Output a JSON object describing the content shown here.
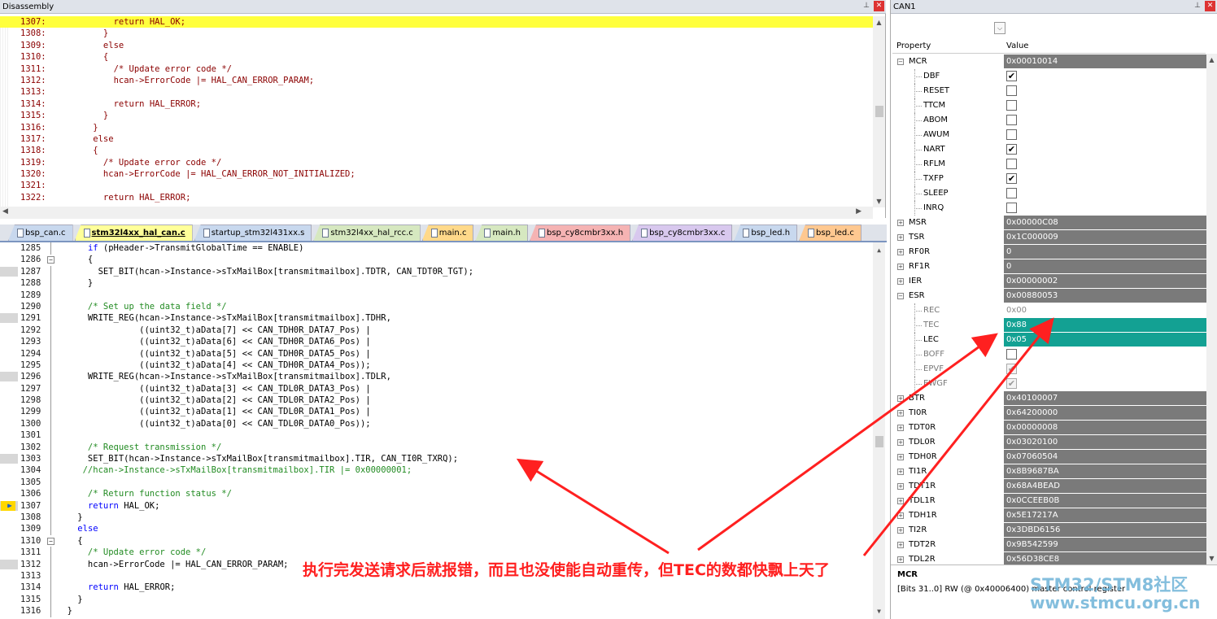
{
  "disassembly": {
    "title": "Disassembly",
    "lines": [
      {
        "num": "1307:",
        "text": "        return HAL_OK;",
        "highlight": true
      },
      {
        "num": "1308:",
        "text": "      }"
      },
      {
        "num": "1309:",
        "text": "      else"
      },
      {
        "num": "1310:",
        "text": "      {"
      },
      {
        "num": "1311:",
        "text": "        /* Update error code */"
      },
      {
        "num": "1312:",
        "text": "        hcan->ErrorCode |= HAL_CAN_ERROR_PARAM;"
      },
      {
        "num": "1313:",
        "text": ""
      },
      {
        "num": "1314:",
        "text": "        return HAL_ERROR;"
      },
      {
        "num": "1315:",
        "text": "      }"
      },
      {
        "num": "1316:",
        "text": "    }"
      },
      {
        "num": "1317:",
        "text": "    else"
      },
      {
        "num": "1318:",
        "text": "    {"
      },
      {
        "num": "1319:",
        "text": "      /* Update error code */"
      },
      {
        "num": "1320:",
        "text": "      hcan->ErrorCode |= HAL_CAN_ERROR_NOT_INITIALIZED;"
      },
      {
        "num": "1321:",
        "text": ""
      },
      {
        "num": "1322:",
        "text": "      return HAL_ERROR;"
      }
    ]
  },
  "tabs": [
    {
      "label": "bsp_can.c",
      "color": "#c8d8ee"
    },
    {
      "label": "stm32l4xx_hal_can.c",
      "color": "#ffff99",
      "active": true
    },
    {
      "label": "startup_stm32l431xx.s",
      "color": "#c8d8ee"
    },
    {
      "label": "stm32l4xx_hal_rcc.c",
      "color": "#d6e8c0"
    },
    {
      "label": "main.c",
      "color": "#ffd98a"
    },
    {
      "label": "main.h",
      "color": "#d6e8c0"
    },
    {
      "label": "bsp_cy8cmbr3xx.h",
      "color": "#f5b3b3"
    },
    {
      "label": "bsp_cy8cmbr3xx.c",
      "color": "#d8c8ee"
    },
    {
      "label": "bsp_led.h",
      "color": "#c8d8ee"
    },
    {
      "label": "bsp_led.c",
      "color": "#ffc890"
    }
  ],
  "tab_controls": {
    "menu": "▼",
    "close": "✕"
  },
  "editor": {
    "lines": [
      {
        "num": "1285",
        "code": [
          [
            "      ",
            ""
          ],
          [
            "if",
            "k"
          ],
          [
            " (pHeader->TransmitGlobalTime == ENABLE)",
            ""
          ]
        ]
      },
      {
        "num": "1286",
        "fold": "−",
        "code": [
          [
            "      {",
            ""
          ]
        ]
      },
      {
        "num": "1287",
        "mark": true,
        "code": [
          [
            "        SET_BIT(hcan->Instance->sTxMailBox[transmitmailbox].TDTR, CAN_TDT0R_TGT);",
            ""
          ]
        ]
      },
      {
        "num": "1288",
        "code": [
          [
            "      }",
            ""
          ]
        ]
      },
      {
        "num": "1289",
        "code": [
          [
            "",
            ""
          ]
        ]
      },
      {
        "num": "1290",
        "code": [
          [
            "      /* Set up the data field */",
            "g"
          ]
        ]
      },
      {
        "num": "1291",
        "mark": true,
        "code": [
          [
            "      WRITE_REG(hcan->Instance->sTxMailBox[transmitmailbox].TDHR,",
            ""
          ]
        ]
      },
      {
        "num": "1292",
        "code": [
          [
            "                ((uint32_t)aData[7] << CAN_TDH0R_DATA7_Pos) |",
            ""
          ]
        ]
      },
      {
        "num": "1293",
        "code": [
          [
            "                ((uint32_t)aData[6] << CAN_TDH0R_DATA6_Pos) |",
            ""
          ]
        ]
      },
      {
        "num": "1294",
        "code": [
          [
            "                ((uint32_t)aData[5] << CAN_TDH0R_DATA5_Pos) |",
            ""
          ]
        ]
      },
      {
        "num": "1295",
        "code": [
          [
            "                ((uint32_t)aData[4] << CAN_TDH0R_DATA4_Pos));",
            ""
          ]
        ]
      },
      {
        "num": "1296",
        "mark": true,
        "code": [
          [
            "      WRITE_REG(hcan->Instance->sTxMailBox[transmitmailbox].TDLR,",
            ""
          ]
        ]
      },
      {
        "num": "1297",
        "code": [
          [
            "                ((uint32_t)aData[3] << CAN_TDL0R_DATA3_Pos) |",
            ""
          ]
        ]
      },
      {
        "num": "1298",
        "code": [
          [
            "                ((uint32_t)aData[2] << CAN_TDL0R_DATA2_Pos) |",
            ""
          ]
        ]
      },
      {
        "num": "1299",
        "code": [
          [
            "                ((uint32_t)aData[1] << CAN_TDL0R_DATA1_Pos) |",
            ""
          ]
        ]
      },
      {
        "num": "1300",
        "code": [
          [
            "                ((uint32_t)aData[0] << CAN_TDL0R_DATA0_Pos));",
            ""
          ]
        ]
      },
      {
        "num": "1301",
        "code": [
          [
            "",
            ""
          ]
        ]
      },
      {
        "num": "1302",
        "code": [
          [
            "      /* Request transmission */",
            "g"
          ]
        ]
      },
      {
        "num": "1303",
        "mark": true,
        "code": [
          [
            "      SET_BIT(hcan->Instance->sTxMailBox[transmitmailbox].TIR, CAN_TI0R_TXRQ);",
            ""
          ]
        ]
      },
      {
        "num": "1304",
        "code": [
          [
            "     //hcan->Instance->sTxMailBox[transmitmailbox].TIR |= 0x00000001;",
            "g"
          ]
        ]
      },
      {
        "num": "1305",
        "code": [
          [
            "",
            ""
          ]
        ]
      },
      {
        "num": "1306",
        "code": [
          [
            "      /* Return function status */",
            "g"
          ]
        ]
      },
      {
        "num": "1307",
        "mark": true,
        "current": true,
        "code": [
          [
            "      ",
            ""
          ],
          [
            "return",
            "k"
          ],
          [
            " HAL_OK;",
            ""
          ]
        ]
      },
      {
        "num": "1308",
        "code": [
          [
            "    }",
            ""
          ]
        ]
      },
      {
        "num": "1309",
        "code": [
          [
            "    ",
            ""
          ],
          [
            "else",
            "k"
          ]
        ]
      },
      {
        "num": "1310",
        "fold": "−",
        "code": [
          [
            "    {",
            ""
          ]
        ]
      },
      {
        "num": "1311",
        "code": [
          [
            "      /* Update error code */",
            "g"
          ]
        ]
      },
      {
        "num": "1312",
        "mark": true,
        "code": [
          [
            "      hcan->ErrorCode |= HAL_CAN_ERROR_PARAM;",
            ""
          ]
        ]
      },
      {
        "num": "1313",
        "code": [
          [
            "",
            ""
          ]
        ]
      },
      {
        "num": "1314",
        "code": [
          [
            "      ",
            ""
          ],
          [
            "return",
            "k"
          ],
          [
            " HAL_ERROR;",
            ""
          ]
        ]
      },
      {
        "num": "1315",
        "code": [
          [
            "    }",
            ""
          ]
        ]
      },
      {
        "num": "1316",
        "code": [
          [
            "  }",
            ""
          ]
        ]
      }
    ]
  },
  "can_panel": {
    "title": "CAN1",
    "header": {
      "property": "Property",
      "value": "Value"
    },
    "rows": [
      {
        "name": "MCR",
        "value": "0x00010014",
        "kind": "expanded",
        "style": "dark"
      },
      {
        "name": "DBF",
        "check": true,
        "kind": "child"
      },
      {
        "name": "RESET",
        "check": false,
        "kind": "child"
      },
      {
        "name": "TTCM",
        "check": false,
        "kind": "child"
      },
      {
        "name": "ABOM",
        "check": false,
        "kind": "child"
      },
      {
        "name": "AWUM",
        "check": false,
        "kind": "child"
      },
      {
        "name": "NART",
        "check": true,
        "kind": "child"
      },
      {
        "name": "RFLM",
        "check": false,
        "kind": "child"
      },
      {
        "name": "TXFP",
        "check": true,
        "kind": "child"
      },
      {
        "name": "SLEEP",
        "check": false,
        "kind": "child"
      },
      {
        "name": "INRQ",
        "check": false,
        "kind": "child"
      },
      {
        "name": "MSR",
        "value": "0x00000C08",
        "kind": "collapsed",
        "style": "dark"
      },
      {
        "name": "TSR",
        "value": "0x1C000009",
        "kind": "collapsed",
        "style": "dark"
      },
      {
        "name": "RF0R",
        "value": "0",
        "kind": "collapsed",
        "style": "dark"
      },
      {
        "name": "RF1R",
        "value": "0",
        "kind": "collapsed",
        "style": "dark"
      },
      {
        "name": "IER",
        "value": "0x00000002",
        "kind": "collapsed",
        "style": "dark"
      },
      {
        "name": "ESR",
        "value": "0x00880053",
        "kind": "expanded",
        "style": "dark"
      },
      {
        "name": "REC",
        "value": "0x00",
        "kind": "child",
        "style": "plain",
        "dim": true
      },
      {
        "name": "TEC",
        "value": "0x88",
        "kind": "child",
        "style": "teal",
        "dim": true
      },
      {
        "name": "LEC",
        "value": "0x05",
        "kind": "child",
        "style": "teal"
      },
      {
        "name": "BOFF",
        "check": false,
        "kind": "child",
        "dim": true
      },
      {
        "name": "EPVF",
        "check": true,
        "kind": "child",
        "dim": true,
        "disabled": true
      },
      {
        "name": "EWGF",
        "check": true,
        "kind": "child",
        "dim": true,
        "disabled": true
      },
      {
        "name": "BTR",
        "value": "0x40100007",
        "kind": "collapsed",
        "style": "dark"
      },
      {
        "name": "TI0R",
        "value": "0x64200000",
        "kind": "collapsed",
        "style": "dark"
      },
      {
        "name": "TDT0R",
        "value": "0x00000008",
        "kind": "collapsed",
        "style": "dark"
      },
      {
        "name": "TDL0R",
        "value": "0x03020100",
        "kind": "collapsed",
        "style": "dark"
      },
      {
        "name": "TDH0R",
        "value": "0x07060504",
        "kind": "collapsed",
        "style": "dark"
      },
      {
        "name": "TI1R",
        "value": "0x8B9687BA",
        "kind": "collapsed",
        "style": "dark"
      },
      {
        "name": "TDT1R",
        "value": "0x68A4BEAD",
        "kind": "collapsed",
        "style": "dark"
      },
      {
        "name": "TDL1R",
        "value": "0x0CCEEB0B",
        "kind": "collapsed",
        "style": "dark"
      },
      {
        "name": "TDH1R",
        "value": "0x5E17217A",
        "kind": "collapsed",
        "style": "dark"
      },
      {
        "name": "TI2R",
        "value": "0x3DBD6156",
        "kind": "collapsed",
        "style": "dark"
      },
      {
        "name": "TDT2R",
        "value": "0x9B542599",
        "kind": "collapsed",
        "style": "dark"
      },
      {
        "name": "TDL2R",
        "value": "0x56D38CE8",
        "kind": "collapsed",
        "style": "dark"
      }
    ],
    "status_title": "MCR",
    "status_desc": "[Bits 31..0] RW (@ 0x40006400) master control register"
  },
  "annotation": "执行完发送请求后就报错，而且也没使能自动重传，但TEC的数都快飘上天了",
  "watermark": {
    "line1": "STM32/STM8社区",
    "line2": "www.stmcu.org.cn"
  },
  "colors": {
    "annotation": "#ff2020",
    "highlight": "#ffff3c",
    "teal": "#13a193",
    "register_dark": "#7a7a7a"
  }
}
